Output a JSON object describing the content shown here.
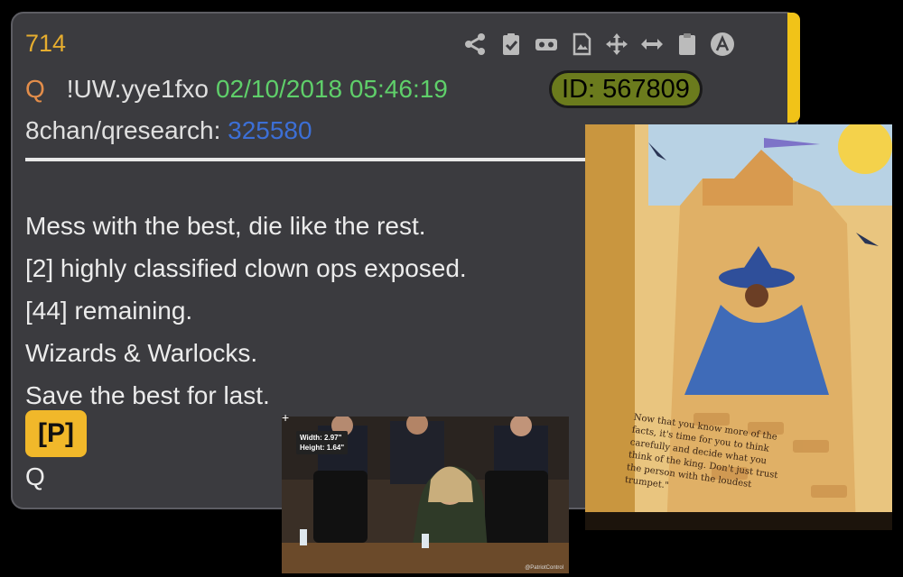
{
  "post": {
    "number": "714",
    "author_letter": "Q",
    "tripcode": "!UW.yye1fxo",
    "datetime": "02/10/2018 05:46:19",
    "id_label": "ID: 567809",
    "board": "8chan/qresearch:",
    "thread_id": "325580",
    "lines": [
      "Mess with the best, die like the rest.",
      "[2] highly classified clown ops exposed.",
      "[44] remaining.",
      "Wizards & Warlocks.",
      "Save the best for last."
    ],
    "p_button": "[P]",
    "signature": "Q"
  },
  "toolbar_icons": [
    "share-icon",
    "clipboard-check-icon",
    "vr-goggles-icon",
    "image-file-icon",
    "move-icon",
    "resize-horizontal-icon",
    "clipboard-icon",
    "a-circle-icon"
  ],
  "book_page_text": "Now that you know more of the facts, it's time for you to think carefully and decide what you think of the king. Don't just trust the person with the loudest trumpet.\"",
  "video_overlay": {
    "width": "Width: 2.97\"",
    "height": "Height: 1.64\"",
    "watermark": "@PatriotControl"
  },
  "colors": {
    "panel": "#3b3b3f",
    "accent": "#f1c318",
    "post_number": "#e6ad2f",
    "date": "#5fcf6a",
    "thread_link": "#3c6fd6",
    "id_badge": "#6b7b1d"
  }
}
